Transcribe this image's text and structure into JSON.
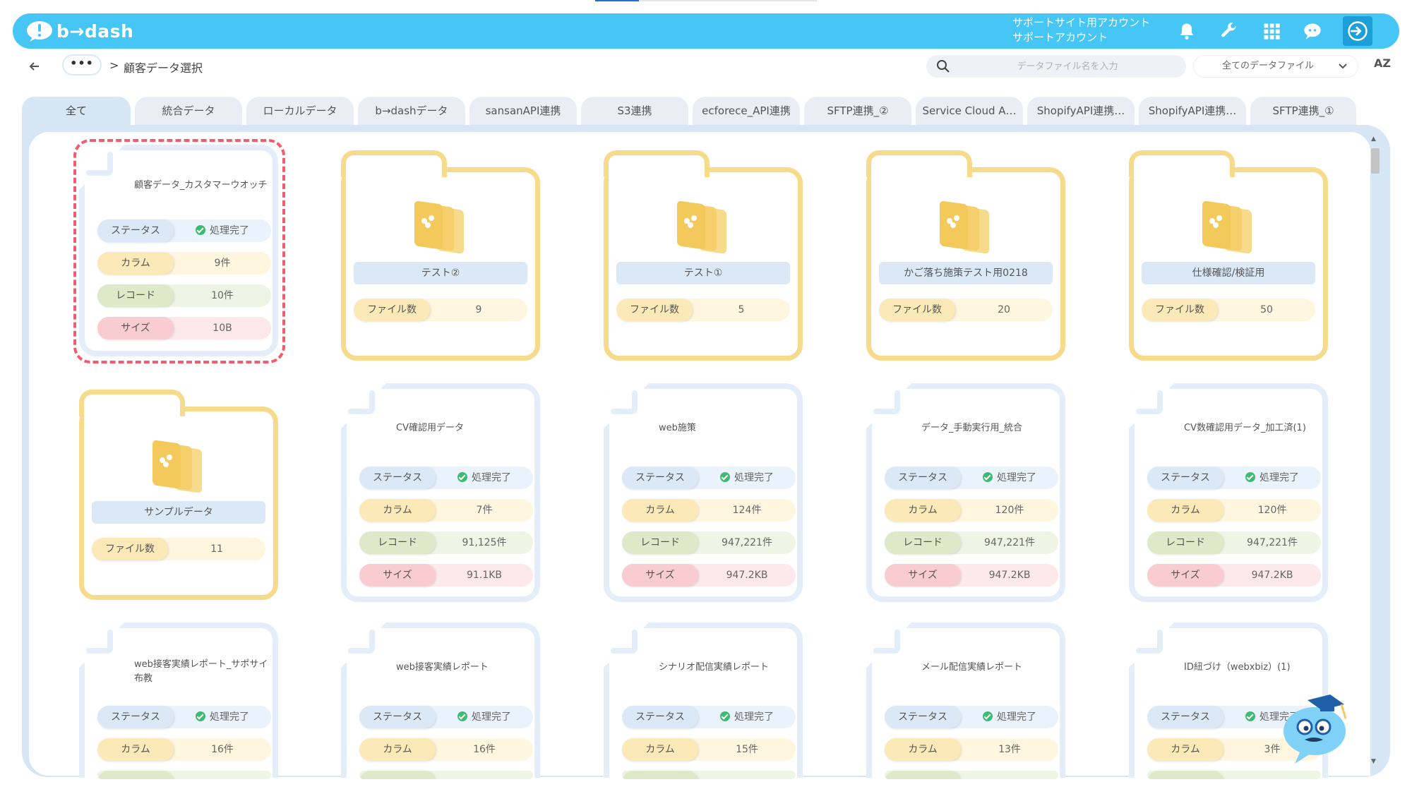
{
  "header": {
    "logo_text": "b→dash",
    "account_line1": "サポートサイト用アカウント",
    "account_line2": "サポートアカウント",
    "icons": [
      "bell-icon",
      "wrench-icon",
      "grid-icon",
      "chat-icon",
      "logout-icon"
    ],
    "accent": "#45c6f4"
  },
  "subbar": {
    "more_label": "•••",
    "crumb_sep": ">",
    "crumb": "顧客データ選択",
    "search_placeholder": "データファイル名を入力",
    "filter_value": "全てのデータファイル",
    "sort_label": "AZ"
  },
  "tabs": [
    {
      "label": "全て"
    },
    {
      "label": "統合データ"
    },
    {
      "label": "ローカルデータ"
    },
    {
      "label": "b→dashデータ"
    },
    {
      "label": "sansanAPI連携"
    },
    {
      "label": "S3連携"
    },
    {
      "label": "ecforece_API連携"
    },
    {
      "label": "SFTP連携_②"
    },
    {
      "label": "Service Cloud A…"
    },
    {
      "label": "ShopifyAPI連携…"
    },
    {
      "label": "ShopifyAPI連携…"
    },
    {
      "label": "SFTP連携_①"
    }
  ],
  "labels": {
    "status": "ステータス",
    "column": "カラム",
    "record": "レコード",
    "size": "サイズ",
    "file_count": "ファイル数",
    "done": "処理完了"
  },
  "row1": [
    {
      "type": "file",
      "name": "顧客データ_カスタマーウオッチ",
      "columns": "9件",
      "records": "10件",
      "size": "10B"
    },
    {
      "type": "folder",
      "name": "テスト②",
      "files": "9"
    },
    {
      "type": "folder",
      "name": "テスト①",
      "files": "5"
    },
    {
      "type": "folder",
      "name": "かご落ち施策テスト用0218",
      "files": "20"
    },
    {
      "type": "folder",
      "name": "仕様確認/検証用",
      "files": "50"
    }
  ],
  "row2": [
    {
      "type": "folder",
      "name": "サンプルデータ",
      "files": "11"
    },
    {
      "type": "file",
      "name": "CV確認用データ",
      "columns": "7件",
      "records": "91,125件",
      "size": "91.1KB"
    },
    {
      "type": "file",
      "name": "web施策",
      "columns": "124件",
      "records": "947,221件",
      "size": "947.2KB"
    },
    {
      "type": "file",
      "name": "データ_手動実行用_統合",
      "columns": "120件",
      "records": "947,221件",
      "size": "947.2KB"
    },
    {
      "type": "file",
      "name": "CV数確認用データ_加工済(1)",
      "columns": "120件",
      "records": "947,221件",
      "size": "947.2KB"
    }
  ],
  "row3": [
    {
      "type": "file",
      "name": "web接客実績レポート_サポサイ布教",
      "columns": "16件"
    },
    {
      "type": "file",
      "name": "web接客実績レポート",
      "columns": "16件"
    },
    {
      "type": "file",
      "name": "シナリオ配信実績レポート",
      "columns": "15件"
    },
    {
      "type": "file",
      "name": "メール配信実績レポート",
      "columns": "13件"
    },
    {
      "type": "file",
      "name": "ID紐づけ（webxbiz）(1)",
      "columns": "3件"
    }
  ]
}
